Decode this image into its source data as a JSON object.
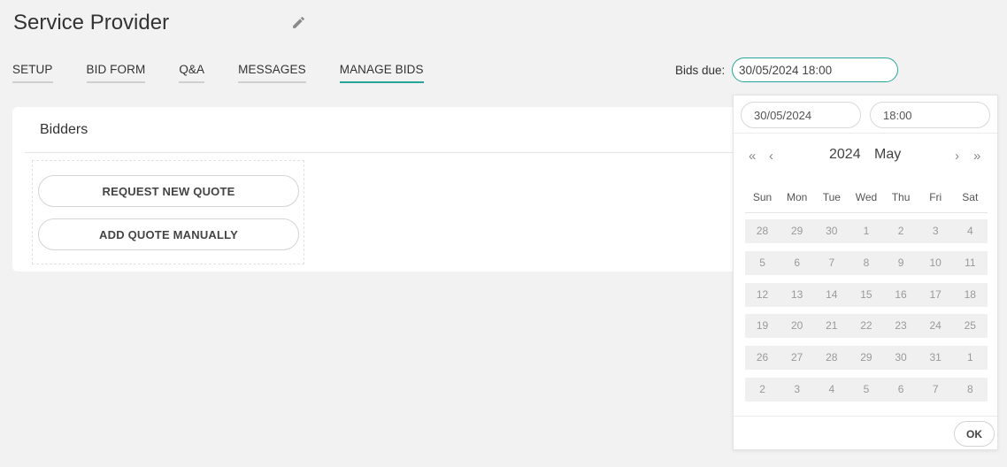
{
  "header": {
    "title": "Service Provider",
    "edit_icon": "pencil-icon"
  },
  "tabs": [
    {
      "label": "SETUP",
      "active": false
    },
    {
      "label": "BID FORM",
      "active": false
    },
    {
      "label": "Q&A",
      "active": false
    },
    {
      "label": "MESSAGES",
      "active": false
    },
    {
      "label": "MANAGE BIDS",
      "active": true
    }
  ],
  "bids_due": {
    "label": "Bids due:",
    "value": "30/05/2024 18:00"
  },
  "card": {
    "title": "Bidders",
    "buttons": {
      "request": "REQUEST NEW QUOTE",
      "manual": "ADD QUOTE MANUALLY"
    }
  },
  "picker": {
    "date_value": "30/05/2024",
    "time_value": "18:00",
    "year": "2024",
    "month": "May",
    "nav": {
      "prev_year": "«",
      "prev_month": "‹",
      "next_month": "›",
      "next_year": "»"
    },
    "weekdays": [
      "Sun",
      "Mon",
      "Tue",
      "Wed",
      "Thu",
      "Fri",
      "Sat"
    ],
    "weeks": [
      [
        "28",
        "29",
        "30",
        "1",
        "2",
        "3",
        "4"
      ],
      [
        "5",
        "6",
        "7",
        "8",
        "9",
        "10",
        "11"
      ],
      [
        "12",
        "13",
        "14",
        "15",
        "16",
        "17",
        "18"
      ],
      [
        "19",
        "20",
        "21",
        "22",
        "23",
        "24",
        "25"
      ],
      [
        "26",
        "27",
        "28",
        "29",
        "30",
        "31",
        "1"
      ],
      [
        "2",
        "3",
        "4",
        "5",
        "6",
        "7",
        "8"
      ]
    ],
    "ok_label": "OK"
  },
  "colors": {
    "accent": "#26a69a",
    "background": "#f2f2f2",
    "card": "#ffffff",
    "day_bg": "#f0f0f0"
  }
}
